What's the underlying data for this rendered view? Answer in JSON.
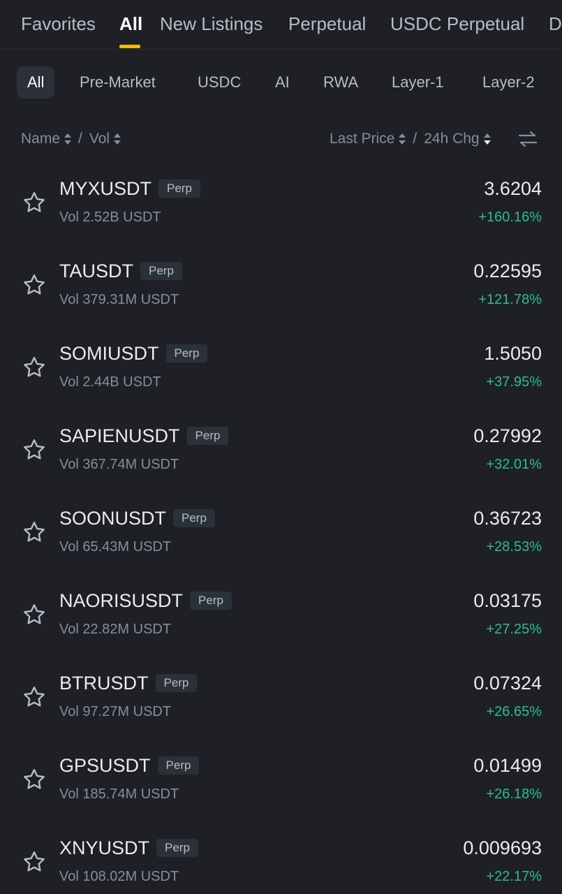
{
  "top_tabs": [
    {
      "label": "Favorites"
    },
    {
      "label": "All"
    },
    {
      "label": "New Listings"
    },
    {
      "label": "Perpetual"
    },
    {
      "label": "USDC Perpetual"
    },
    {
      "label": "D"
    }
  ],
  "chips": [
    {
      "label": "All"
    },
    {
      "label": "Pre-Market"
    },
    {
      "label": "USDC"
    },
    {
      "label": "AI"
    },
    {
      "label": "RWA"
    },
    {
      "label": "Layer-1"
    },
    {
      "label": "Layer-2"
    }
  ],
  "columns": {
    "name": "Name",
    "vol": "Vol",
    "last_price": "Last Price",
    "change": "24h Chg",
    "separator": "/"
  },
  "rows": [
    {
      "symbol": "MYXUSDT",
      "badge": "Perp",
      "volume": "Vol 2.52B USDT",
      "price": "3.6204",
      "change": "+160.16%"
    },
    {
      "symbol": "TAUSDT",
      "badge": "Perp",
      "volume": "Vol 379.31M USDT",
      "price": "0.22595",
      "change": "+121.78%"
    },
    {
      "symbol": "SOMIUSDT",
      "badge": "Perp",
      "volume": "Vol 2.44B USDT",
      "price": "1.5050",
      "change": "+37.95%"
    },
    {
      "symbol": "SAPIENUSDT",
      "badge": "Perp",
      "volume": "Vol 367.74M USDT",
      "price": "0.27992",
      "change": "+32.01%"
    },
    {
      "symbol": "SOONUSDT",
      "badge": "Perp",
      "volume": "Vol 65.43M USDT",
      "price": "0.36723",
      "change": "+28.53%"
    },
    {
      "symbol": "NAORISUSDT",
      "badge": "Perp",
      "volume": "Vol 22.82M USDT",
      "price": "0.03175",
      "change": "+27.25%"
    },
    {
      "symbol": "BTRUSDT",
      "badge": "Perp",
      "volume": "Vol 97.27M USDT",
      "price": "0.07324",
      "change": "+26.65%"
    },
    {
      "symbol": "GPSUSDT",
      "badge": "Perp",
      "volume": "Vol 185.74M USDT",
      "price": "0.01499",
      "change": "+26.18%"
    },
    {
      "symbol": "XNYUSDT",
      "badge": "Perp",
      "volume": "Vol 108.02M USDT",
      "price": "0.009693",
      "change": "+22.17%"
    }
  ],
  "icons": {
    "star": "star-outline-icon",
    "swap": "swap-arrows-icon",
    "sort": "sort-arrows-icon"
  },
  "colors": {
    "background": "#1e2026",
    "accent": "#f0b90b",
    "positive": "#2ebd85",
    "text_primary": "#eaecef",
    "text_secondary": "#848e9c"
  }
}
